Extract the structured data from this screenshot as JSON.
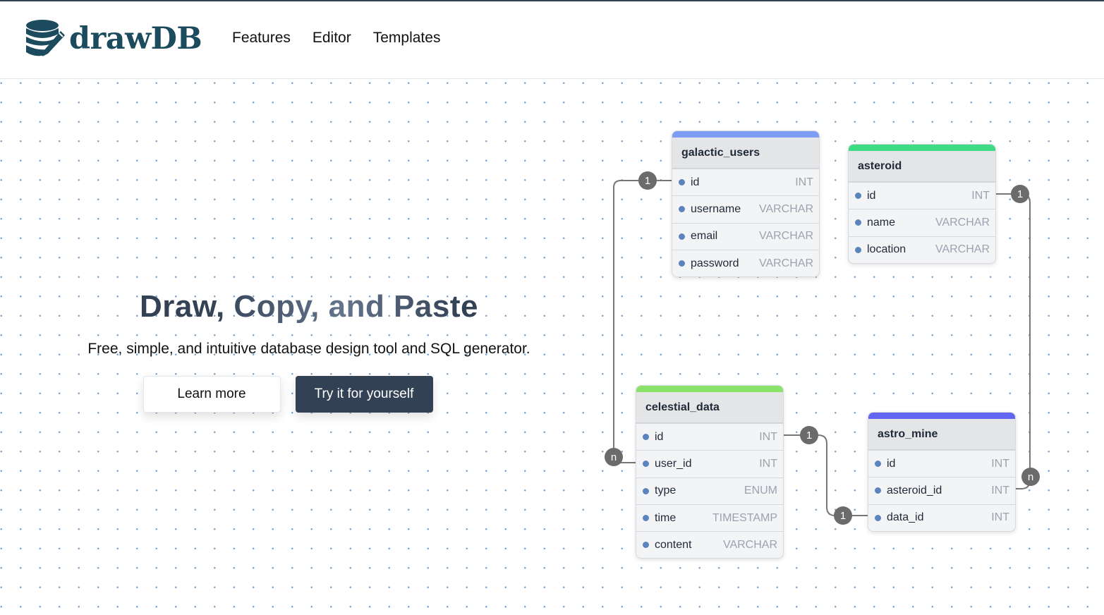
{
  "header": {
    "brand": "drawDB",
    "brand_color": "#1c4b5e",
    "nav": [
      {
        "label": "Features"
      },
      {
        "label": "Editor"
      },
      {
        "label": "Templates"
      }
    ]
  },
  "hero": {
    "title": "Draw, Copy, and Paste",
    "subtitle": "Free, simple, and intuitive database design tool and SQL generator.",
    "learn_more": "Learn more",
    "try_it": "Try it for yourself"
  },
  "diagram": {
    "tables": [
      {
        "name": "galactic_users",
        "color": "#7f9cf5",
        "fields": [
          {
            "name": "id",
            "type": "INT"
          },
          {
            "name": "username",
            "type": "VARCHAR"
          },
          {
            "name": "email",
            "type": "VARCHAR"
          },
          {
            "name": "password",
            "type": "VARCHAR"
          }
        ]
      },
      {
        "name": "asteroid",
        "color": "#3ddc84",
        "fields": [
          {
            "name": "id",
            "type": "INT"
          },
          {
            "name": "name",
            "type": "VARCHAR"
          },
          {
            "name": "location",
            "type": "VARCHAR"
          }
        ]
      },
      {
        "name": "celestial_data",
        "color": "#89e36b",
        "fields": [
          {
            "name": "id",
            "type": "INT"
          },
          {
            "name": "user_id",
            "type": "INT"
          },
          {
            "name": "type",
            "type": "ENUM"
          },
          {
            "name": "time",
            "type": "TIMESTAMP"
          },
          {
            "name": "content",
            "type": "VARCHAR"
          }
        ]
      },
      {
        "name": "astro_mine",
        "color": "#6366f1",
        "fields": [
          {
            "name": "id",
            "type": "INT"
          },
          {
            "name": "asteroid_id",
            "type": "INT"
          },
          {
            "name": "data_id",
            "type": "INT"
          }
        ]
      }
    ],
    "relationships": [
      {
        "from": "galactic_users.id",
        "to": "celestial_data.user_id",
        "from_card": "1",
        "to_card": "n"
      },
      {
        "from": "asteroid.id",
        "to": "astro_mine.asteroid_id",
        "from_card": "1",
        "to_card": "n"
      },
      {
        "from": "celestial_data.id",
        "to": "astro_mine.data_id",
        "from_card": "1",
        "to_card": "1"
      }
    ]
  }
}
